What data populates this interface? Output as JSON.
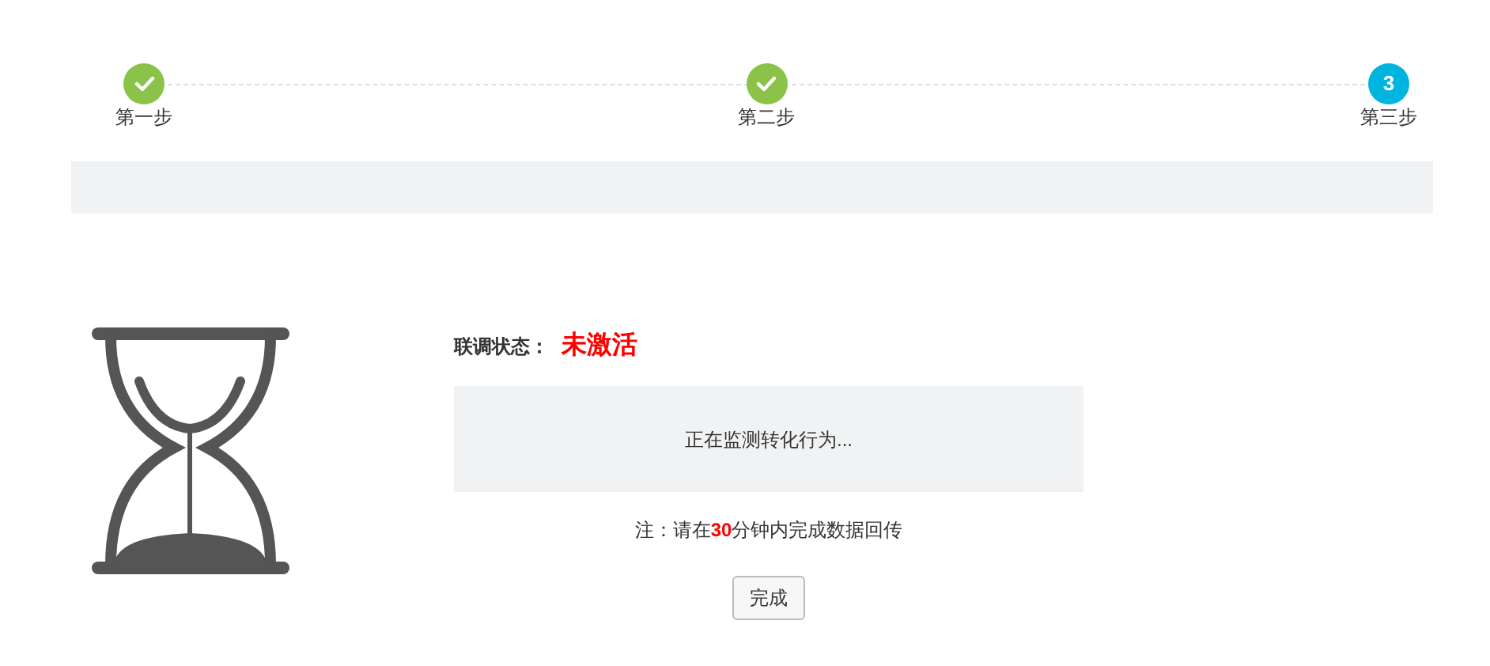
{
  "steps": [
    {
      "label": "第一步",
      "completed": true
    },
    {
      "label": "第二步",
      "completed": true
    },
    {
      "label": "第三步",
      "completed": false,
      "number": "3"
    }
  ],
  "status": {
    "label": "联调状态：",
    "value": "未激活"
  },
  "monitor_message": "正在监测转化行为...",
  "note": "注：请在**30**分钟内完成数据回传",
  "buttons": [
    "完成"
  ]
}
